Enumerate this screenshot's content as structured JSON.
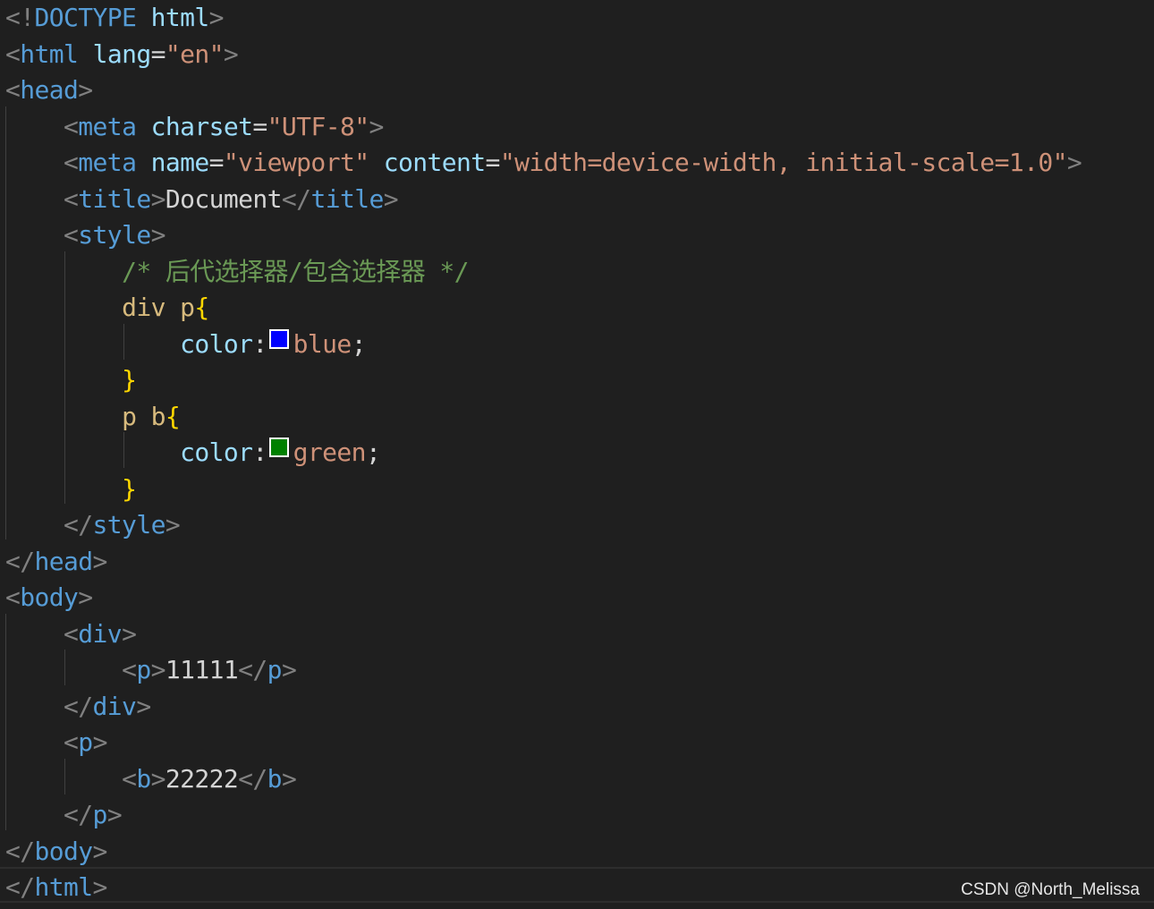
{
  "colors": {
    "background": "#1f1f1f",
    "punctuation": "#808080",
    "tag": "#569cd6",
    "attribute": "#9cdcfe",
    "string": "#ce9178",
    "comment": "#6a9955",
    "selector": "#d7ba7d",
    "brace": "#ffd700",
    "text": "#d4d4d4"
  },
  "swatches": {
    "blue": "#0000ff",
    "green": "#008000"
  },
  "code_lines": [
    [
      [
        "punct",
        "<!"
      ],
      [
        "tag",
        "DOCTYPE"
      ],
      [
        "text",
        " "
      ],
      [
        "attr",
        "html"
      ],
      [
        "punct",
        ">"
      ]
    ],
    [
      [
        "punct",
        "<"
      ],
      [
        "tag",
        "html"
      ],
      [
        "text",
        " "
      ],
      [
        "attr",
        "lang"
      ],
      [
        "text",
        "="
      ],
      [
        "str",
        "\"en\""
      ],
      [
        "punct",
        ">"
      ]
    ],
    [
      [
        "punct",
        "<"
      ],
      [
        "tag",
        "head"
      ],
      [
        "punct",
        ">"
      ]
    ],
    [
      [
        "text",
        "    "
      ],
      [
        "punct",
        "<"
      ],
      [
        "tag",
        "meta"
      ],
      [
        "text",
        " "
      ],
      [
        "attr",
        "charset"
      ],
      [
        "text",
        "="
      ],
      [
        "str",
        "\"UTF-8\""
      ],
      [
        "punct",
        ">"
      ]
    ],
    [
      [
        "text",
        "    "
      ],
      [
        "punct",
        "<"
      ],
      [
        "tag",
        "meta"
      ],
      [
        "text",
        " "
      ],
      [
        "attr",
        "name"
      ],
      [
        "text",
        "="
      ],
      [
        "str",
        "\"viewport\""
      ],
      [
        "text",
        " "
      ],
      [
        "attr",
        "content"
      ],
      [
        "text",
        "="
      ],
      [
        "str",
        "\"width=device-width, initial-scale=1.0\""
      ],
      [
        "punct",
        ">"
      ]
    ],
    [
      [
        "text",
        "    "
      ],
      [
        "punct",
        "<"
      ],
      [
        "tag",
        "title"
      ],
      [
        "punct",
        ">"
      ],
      [
        "text",
        "Document"
      ],
      [
        "punct",
        "</"
      ],
      [
        "tag",
        "title"
      ],
      [
        "punct",
        ">"
      ]
    ],
    [
      [
        "text",
        "    "
      ],
      [
        "punct",
        "<"
      ],
      [
        "tag",
        "style"
      ],
      [
        "punct",
        ">"
      ]
    ],
    [
      [
        "text",
        "        "
      ],
      [
        "comment",
        "/* 后代选择器/包含选择器 */"
      ]
    ],
    [
      [
        "text",
        "        "
      ],
      [
        "sel",
        "div p"
      ],
      [
        "brace",
        "{"
      ]
    ],
    [
      [
        "text",
        "            "
      ],
      [
        "attr",
        "color"
      ],
      [
        "text",
        ":"
      ],
      [
        "swatch",
        "blue"
      ],
      [
        "str",
        "blue"
      ],
      [
        "text",
        ";"
      ]
    ],
    [
      [
        "text",
        "        "
      ],
      [
        "brace",
        "}"
      ]
    ],
    [
      [
        "text",
        "        "
      ],
      [
        "sel",
        "p b"
      ],
      [
        "brace",
        "{"
      ]
    ],
    [
      [
        "text",
        "            "
      ],
      [
        "attr",
        "color"
      ],
      [
        "text",
        ":"
      ],
      [
        "swatch",
        "green"
      ],
      [
        "str",
        "green"
      ],
      [
        "text",
        ";"
      ]
    ],
    [
      [
        "text",
        "        "
      ],
      [
        "brace",
        "}"
      ]
    ],
    [
      [
        "text",
        "    "
      ],
      [
        "punct",
        "</"
      ],
      [
        "tag",
        "style"
      ],
      [
        "punct",
        ">"
      ]
    ],
    [
      [
        "punct",
        "</"
      ],
      [
        "tag",
        "head"
      ],
      [
        "punct",
        ">"
      ]
    ],
    [
      [
        "punct",
        "<"
      ],
      [
        "tag",
        "body"
      ],
      [
        "punct",
        ">"
      ]
    ],
    [
      [
        "text",
        "    "
      ],
      [
        "punct",
        "<"
      ],
      [
        "tag",
        "div"
      ],
      [
        "punct",
        ">"
      ]
    ],
    [
      [
        "text",
        "        "
      ],
      [
        "punct",
        "<"
      ],
      [
        "tag",
        "p"
      ],
      [
        "punct",
        ">"
      ],
      [
        "text",
        "11111"
      ],
      [
        "punct",
        "</"
      ],
      [
        "tag",
        "p"
      ],
      [
        "punct",
        ">"
      ]
    ],
    [
      [
        "text",
        "    "
      ],
      [
        "punct",
        "</"
      ],
      [
        "tag",
        "div"
      ],
      [
        "punct",
        ">"
      ]
    ],
    [
      [
        "text",
        "    "
      ],
      [
        "punct",
        "<"
      ],
      [
        "tag",
        "p"
      ],
      [
        "punct",
        ">"
      ]
    ],
    [
      [
        "text",
        "        "
      ],
      [
        "punct",
        "<"
      ],
      [
        "tag",
        "b"
      ],
      [
        "punct",
        ">"
      ],
      [
        "text",
        "22222"
      ],
      [
        "punct",
        "</"
      ],
      [
        "tag",
        "b"
      ],
      [
        "punct",
        ">"
      ]
    ],
    [
      [
        "text",
        "    "
      ],
      [
        "punct",
        "</"
      ],
      [
        "tag",
        "p"
      ],
      [
        "punct",
        ">"
      ]
    ],
    [
      [
        "punct",
        "</"
      ],
      [
        "tag",
        "body"
      ],
      [
        "punct",
        ">"
      ]
    ],
    [
      [
        "punct",
        "</"
      ],
      [
        "tag",
        "html"
      ],
      [
        "punct",
        ">"
      ]
    ]
  ],
  "watermark": "CSDN @North_Melissa"
}
